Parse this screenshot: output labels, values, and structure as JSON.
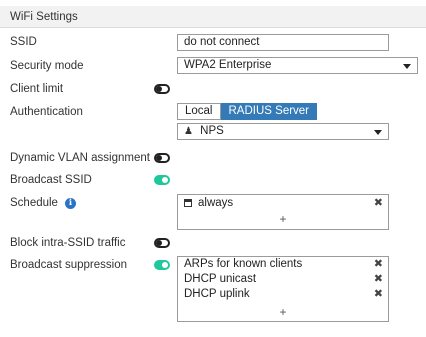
{
  "header": {
    "title": "WiFi Settings"
  },
  "fields": {
    "ssid_label": "SSID",
    "ssid_value": "do not connect",
    "security_label": "Security mode",
    "security_value": "WPA2 Enterprise",
    "client_limit_label": "Client limit",
    "client_limit_on": false,
    "auth_label": "Authentication",
    "auth_options": [
      "Local",
      "RADIUS Server"
    ],
    "auth_selected": "RADIUS Server",
    "radius_server_value": "NPS",
    "dynamic_vlan_label": "Dynamic VLAN assignment",
    "dynamic_vlan_on": false,
    "broadcast_ssid_label": "Broadcast SSID",
    "broadcast_ssid_on": true,
    "schedule_label": "Schedule",
    "schedule_items": [
      "always"
    ],
    "block_intra_label": "Block intra-SSID traffic",
    "block_intra_on": false,
    "broadcast_supp_label": "Broadcast suppression",
    "broadcast_supp_on": true,
    "broadcast_supp_items": [
      "ARPs for known clients",
      "DHCP unicast",
      "DHCP uplink"
    ]
  },
  "icons": {
    "remove": "✖",
    "add": "+",
    "info": "i",
    "users": "users-icon",
    "schedule": "calendar-icon"
  },
  "colors": {
    "toggle_on": "#1fc79a",
    "toggle_off_border": "#222222",
    "active_segment": "#337ab7",
    "info_icon": "#2a73c6",
    "header_bg": "#f2f2f2"
  }
}
